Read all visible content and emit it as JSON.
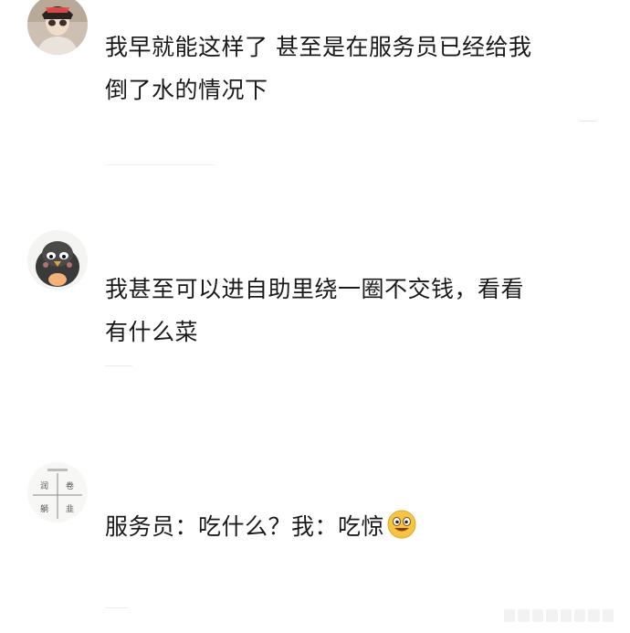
{
  "comments": [
    {
      "avatar_icon": "user-photo-avatar",
      "text_line1": "我早就能这样了 甚至是在服务员已经给我",
      "text_line2": "倒了水的情况下"
    },
    {
      "avatar_icon": "cartoon-bird-avatar",
      "text_line1": "我甚至可以进自助里绕一圈不交钱，看看",
      "text_line2": "有什么菜"
    },
    {
      "avatar_icon": "grid-sticker-avatar",
      "text": "服务员：吃什么？我：吃惊",
      "emoji_icon": "grinning-emoji-icon",
      "avatar_cells": [
        "润",
        "卷",
        "躺",
        "韭"
      ]
    }
  ],
  "colors": {
    "text": "#1a1a1a",
    "background": "#ffffff",
    "emoji_yellow": "#f6c443"
  }
}
